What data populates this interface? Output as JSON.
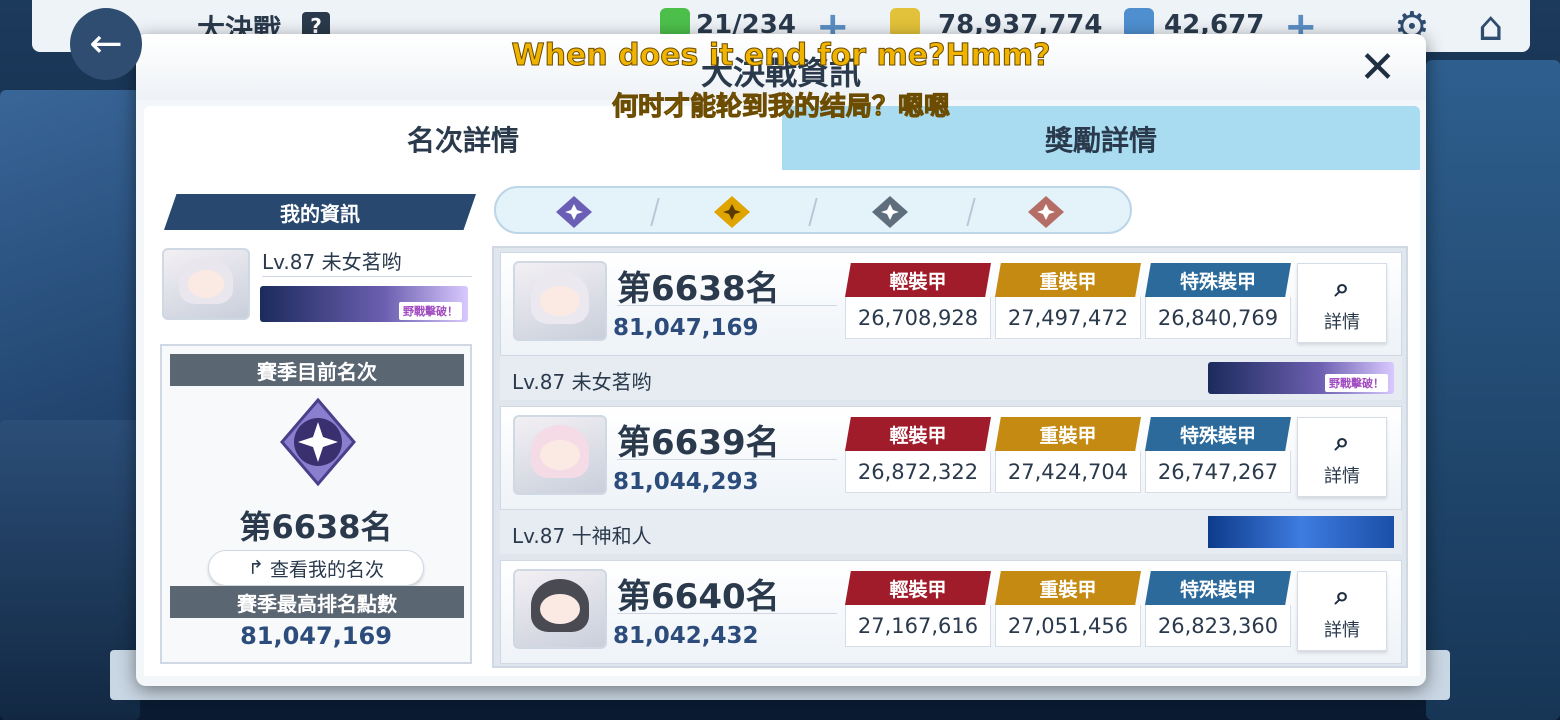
{
  "hud": {
    "title": "大決戰",
    "help": "?",
    "stamina": "21/234",
    "credits": "78,937,774",
    "gems": "42,677",
    "back_icon": "arrow-left-icon",
    "settings_icon": "gear-icon",
    "home_icon": "home-icon"
  },
  "dialog": {
    "title": "大決戰資訊",
    "close_label": "✕"
  },
  "subtitles": {
    "en": "When does it end for me?Hmm?",
    "zh": "何时才能轮到我的结局？嗯嗯"
  },
  "tabs": [
    {
      "label": "名次詳情",
      "active": true
    },
    {
      "label": "獎勵詳情",
      "active": false
    }
  ],
  "my_info": {
    "header": "我的資訊",
    "name": "Lv.87 未女茗哟",
    "banner_text": "野戰擊破！",
    "season_rank_label": "賽季目前名次",
    "season_rank": "第6638名",
    "view_rank_label": "查看我的名次",
    "best_score_label": "賽季最高排名點數",
    "best_score": "81,047,169"
  },
  "tiers": [
    {
      "name": "platinum-tier-icon",
      "color": "#6a5fb5"
    },
    {
      "name": "gold-tier-icon",
      "color": "#e0a400"
    },
    {
      "name": "silver-tier-icon",
      "color": "#5f6e7c"
    },
    {
      "name": "bronze-tier-icon",
      "color": "#b46e66"
    }
  ],
  "armor_labels": {
    "light": "輕裝甲",
    "heavy": "重裝甲",
    "special": "特殊裝甲"
  },
  "detail_label": "詳情",
  "rows": [
    {
      "rank": "第6638名",
      "score": "81,047,169",
      "light": "26,708,928",
      "heavy": "27,497,472",
      "special": "26,840,769",
      "name": "Lv.87 未女茗哟",
      "banner_text": "野戰擊破！"
    },
    {
      "rank": "第6639名",
      "score": "81,044,293",
      "light": "26,872,322",
      "heavy": "27,424,704",
      "special": "26,747,267",
      "name": "Lv.87 十神和人",
      "banner_text": ""
    },
    {
      "rank": "第6640名",
      "score": "81,042,432",
      "light": "27,167,616",
      "heavy": "27,051,456",
      "special": "26,823,360",
      "name": "",
      "banner_text": ""
    }
  ]
}
